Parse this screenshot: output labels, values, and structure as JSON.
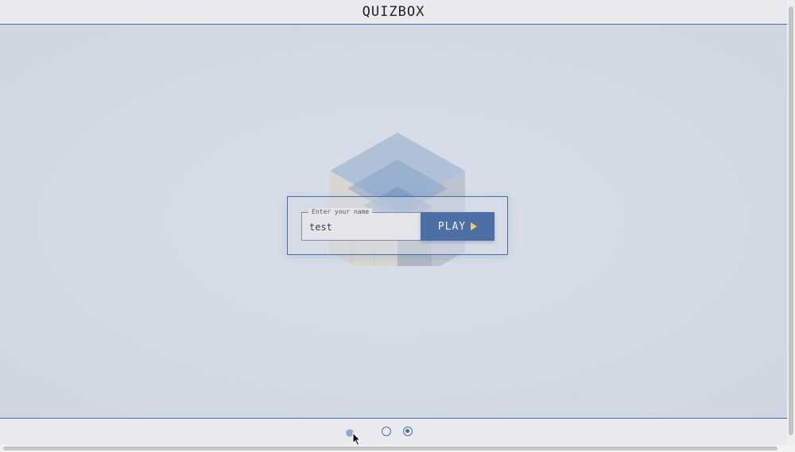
{
  "header": {
    "title": "QUIZBOX"
  },
  "login": {
    "field_label": "Enter your name",
    "name_value": "test",
    "play_label": "PLAY"
  },
  "footer": {
    "dots": [
      "dot-1",
      "dot-2",
      "dot-3"
    ],
    "selected_dot": 3
  },
  "colors": {
    "accent": "#4a6ea8",
    "play_button": "#4c6fa5",
    "play_icon": "#f0c96d",
    "background": "#d2d9e3"
  },
  "icons": {
    "play": "play-triangle-icon",
    "cursor": "mouse-pointer-icon",
    "logo": "cube-logo"
  }
}
